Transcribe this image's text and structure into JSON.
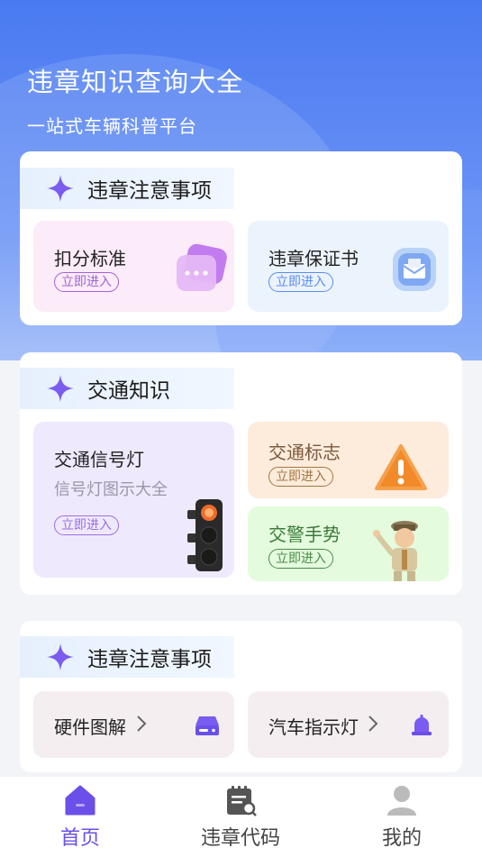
{
  "header": {
    "title": "违章知识查询大全",
    "subtitle": "一站式车辆科普平台"
  },
  "section1": {
    "title": "违章注意事项",
    "tiles": [
      {
        "name": "扣分标准",
        "action": "立即进入",
        "icon": "chat-bubble-icon"
      },
      {
        "name": "违章保证书",
        "action": "立即进入",
        "icon": "mail-icon"
      }
    ]
  },
  "section2": {
    "title": "交通知识",
    "tiles": [
      {
        "name": "交通信号灯",
        "desc": "信号灯图示大全",
        "action": "立即进入",
        "icon": "traffic-light-icon"
      },
      {
        "name": "交通标志",
        "action": "立即进入",
        "icon": "warning-sign-icon"
      },
      {
        "name": "交警手势",
        "action": "立即进入",
        "icon": "police-figure-icon"
      }
    ]
  },
  "section3": {
    "title": "违章注意事项",
    "tiles": [
      {
        "name": "硬件图解",
        "icon": "hard-drive-icon"
      },
      {
        "name": "汽车指示灯",
        "icon": "alarm-light-icon"
      }
    ]
  },
  "nav": {
    "items": [
      {
        "label": "首页",
        "icon": "home-icon",
        "active": true
      },
      {
        "label": "违章代码",
        "icon": "code-doc-icon",
        "active": false
      },
      {
        "label": "我的",
        "icon": "user-icon",
        "active": false
      }
    ]
  },
  "colors": {
    "accent": "#7a5cf0",
    "heroBlue": "#4a7af2",
    "navActive": "#6a4fe8",
    "navInactive": "#444444"
  }
}
